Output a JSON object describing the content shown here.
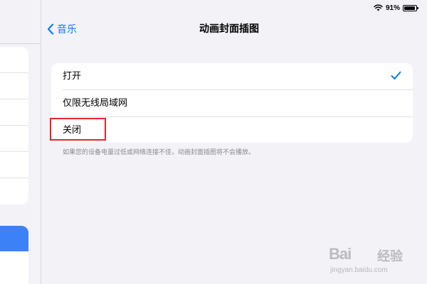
{
  "status_bar": {
    "battery_text": "91%",
    "battery_level": 0.91
  },
  "nav": {
    "back_label": "音乐",
    "title": "动画封面插图"
  },
  "options": [
    {
      "label": "打开",
      "selected": true
    },
    {
      "label": "仅限无线局域网",
      "selected": false
    },
    {
      "label": "关闭",
      "selected": false
    }
  ],
  "footnote": "如果您的设备电量过低或网络连接不佳，动画封面插图将不会播放。",
  "watermark": {
    "logo": "Bai",
    "cn": "经验",
    "url": "jingyan.baidu.com"
  },
  "colors": {
    "accent": "#0a7aff",
    "highlight": "#e8232e",
    "background": "#f2f2f7"
  }
}
